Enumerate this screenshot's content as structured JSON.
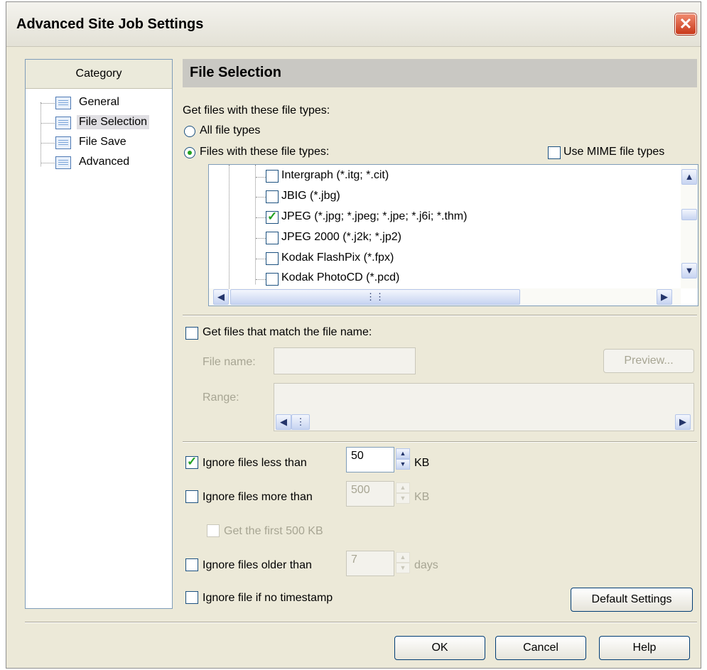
{
  "window": {
    "title": "Advanced Site Job Settings"
  },
  "category": {
    "header": "Category",
    "items": [
      {
        "label": "General"
      },
      {
        "label": "File Selection",
        "selected": true
      },
      {
        "label": "File Save"
      },
      {
        "label": "Advanced"
      }
    ]
  },
  "section": {
    "title": "File Selection"
  },
  "file_types": {
    "group_label": "Get files with these file types:",
    "radio_all": "All file types",
    "radio_these": "Files with these file types:",
    "selected_radio": "these",
    "mime_label": "Use MIME file types",
    "mime_checked": false,
    "list": [
      {
        "label": "Intergraph (*.itg; *.cit)",
        "checked": false
      },
      {
        "label": "JBIG (*.jbg)",
        "checked": false
      },
      {
        "label": "JPEG (*.jpg; *.jpeg; *.jpe; *.j6i; *.thm)",
        "checked": true
      },
      {
        "label": "JPEG 2000 (*.j2k; *.jp2)",
        "checked": false
      },
      {
        "label": "Kodak FlashPix (*.fpx)",
        "checked": false
      },
      {
        "label": "Kodak PhotoCD (*.pcd)",
        "checked": false
      }
    ]
  },
  "file_name": {
    "checkbox_label": "Get files that match the file name:",
    "checked": false,
    "file_name_label": "File name:",
    "file_name_value": "",
    "preview_button": "Preview...",
    "range_label": "Range:"
  },
  "filters": {
    "less_than": {
      "label": "Ignore files less than",
      "checked": true,
      "value": "50",
      "unit": "KB"
    },
    "more_than": {
      "label": "Ignore files more than",
      "checked": false,
      "value": "500",
      "unit": "KB"
    },
    "first": {
      "label": "Get the first 500 KB",
      "checked": false
    },
    "older_than": {
      "label": "Ignore files older than",
      "checked": false,
      "value": "7",
      "unit": "days"
    },
    "no_timestamp": {
      "label": "Ignore file if no timestamp",
      "checked": false
    }
  },
  "buttons": {
    "default_settings": "Default Settings",
    "ok": "OK",
    "cancel": "Cancel",
    "help": "Help"
  },
  "icons": {
    "close": "close-icon",
    "tree_item": "page-icon",
    "scroll_up": "arrow-up-icon",
    "scroll_down": "arrow-down-icon",
    "scroll_left": "arrow-left-icon",
    "scroll_right": "arrow-right-icon"
  }
}
